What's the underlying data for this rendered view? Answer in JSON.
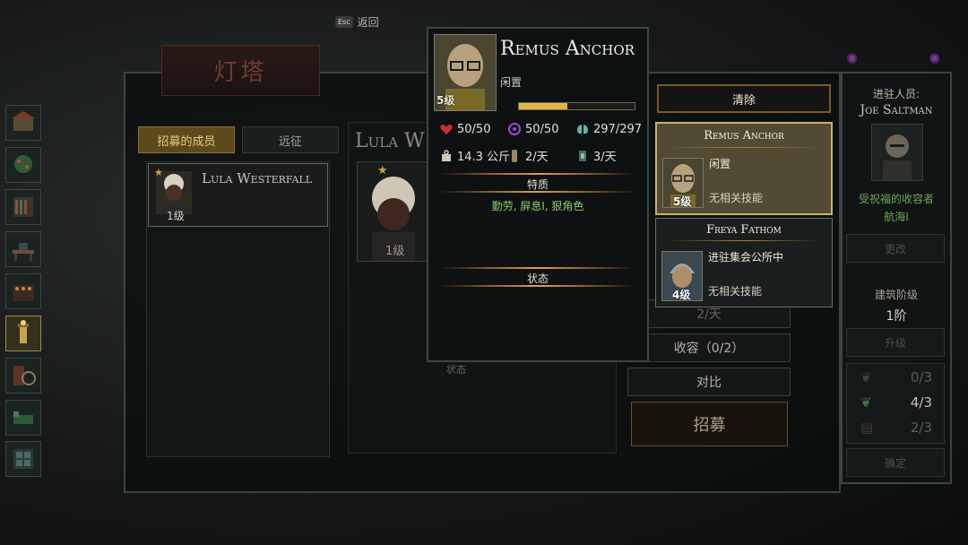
{
  "nav": {
    "esc_key": "Esc",
    "back_label": "返回"
  },
  "building": {
    "title": "灯塔"
  },
  "tabs": {
    "recruited": "招募的成员",
    "expedition": "远征"
  },
  "roster": [
    {
      "name": "Lula Westerfall",
      "level": "1级"
    }
  ],
  "detail_background": {
    "name": "Lula W",
    "level": "1级",
    "status_label": "状态"
  },
  "action_buttons": {
    "daily": "2/天",
    "shelter": "收容（0/2）",
    "compare": "对比",
    "recruit": "招募"
  },
  "popup": {
    "name": "Remus Anchor",
    "level": "5级",
    "status": "闲置",
    "xp_fraction": 0.42,
    "health": "50/50",
    "sanity": "50/50",
    "stamina": "297/297",
    "carry_weight": "14.3 公斤",
    "food": "2/天",
    "water": "3/天",
    "traits_label": "特质",
    "traits": "勤劳, 屏息I, 狠角色",
    "state_label": "状态"
  },
  "clear_button": "清除",
  "recruit_cards": [
    {
      "name": "Remus Anchor",
      "level": "5级",
      "status": "闲置",
      "skill": "无相关技能"
    },
    {
      "name": "Freya Fathom",
      "level": "4级",
      "status": "进驻集会公所中",
      "skill": "无相关技能"
    }
  ],
  "right_panel": {
    "resident_label": "进驻人员:",
    "resident_name": "Joe Saltman",
    "trait_line1": "受祝福的收容者",
    "trait_line2": "航海I",
    "change_button": "更改",
    "stage_label": "建筑阶级",
    "stage_value": "1阶",
    "upgrade_button": "升级",
    "resources": [
      "0/3",
      "4/3",
      "2/3"
    ],
    "confirm_button": "确定"
  },
  "colors": {
    "accent_gold": "#e1b546",
    "trait_green": "#8fd06a",
    "frame": "#3b4644"
  }
}
